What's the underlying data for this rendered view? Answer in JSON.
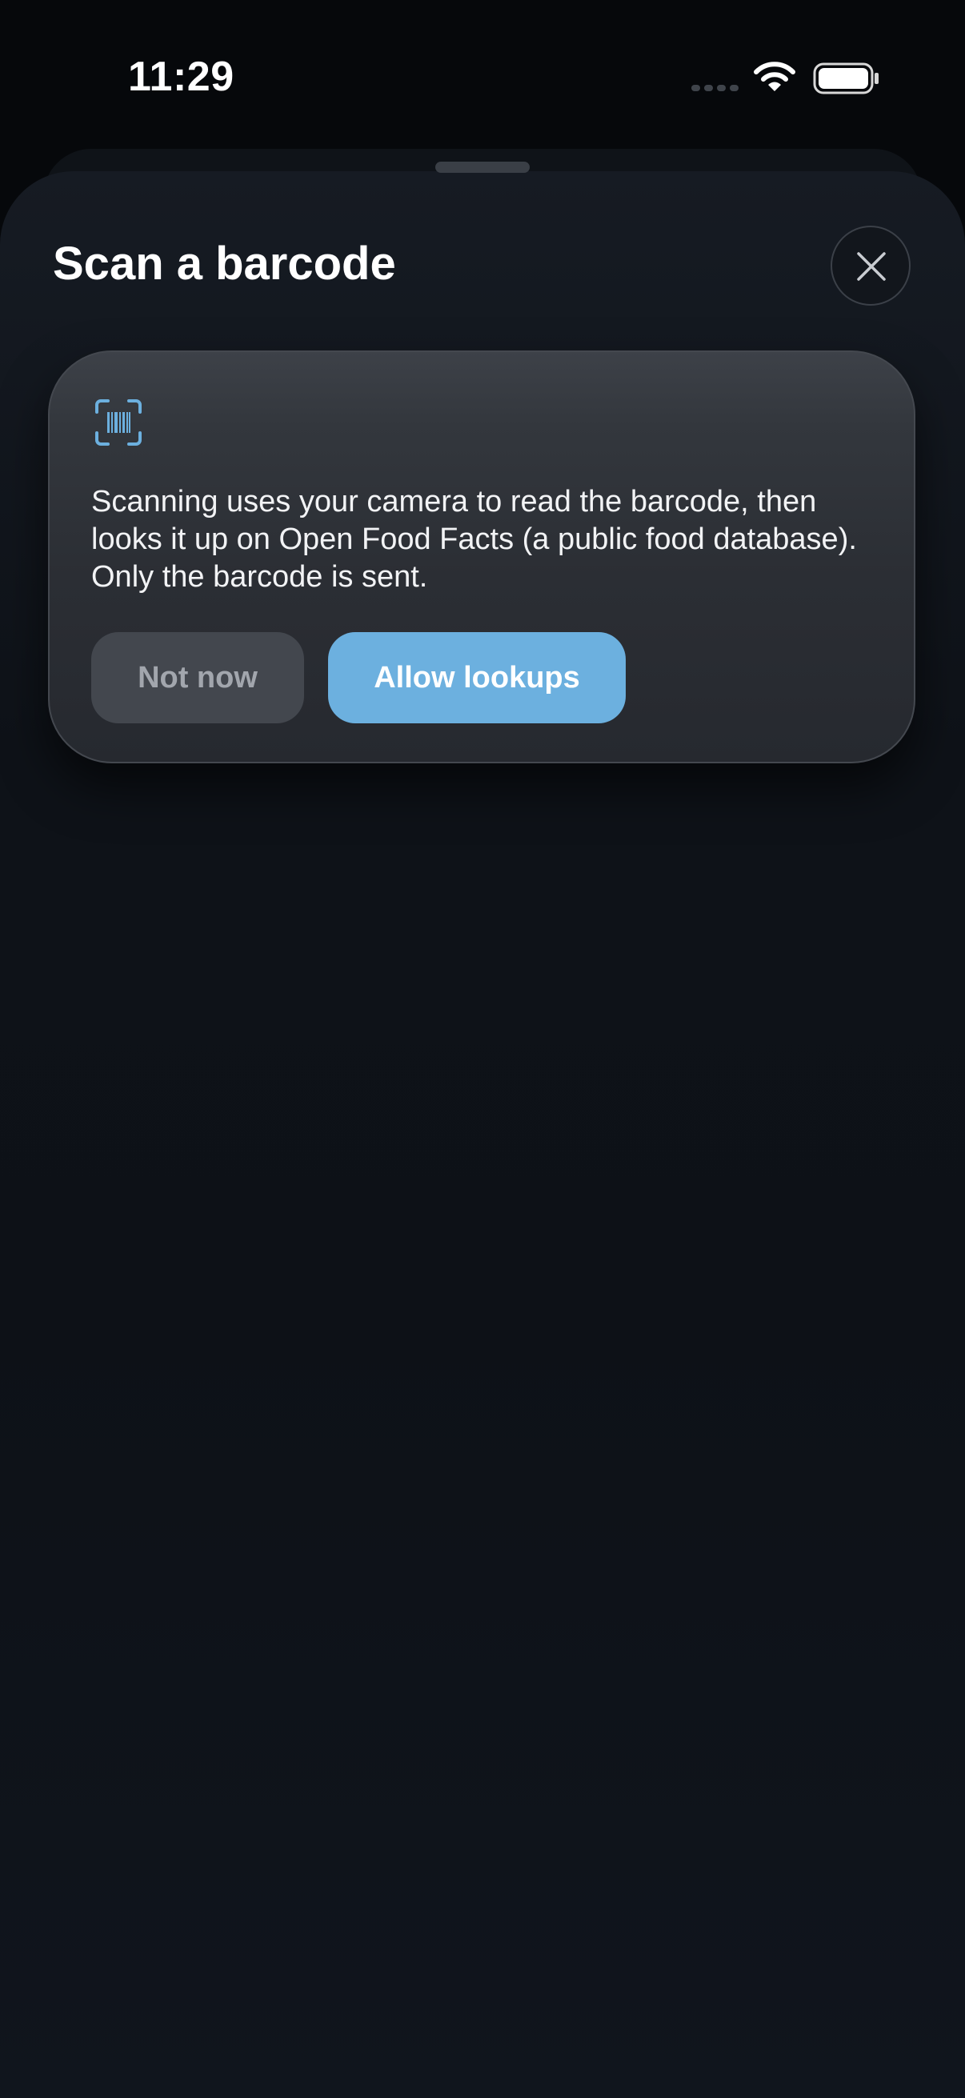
{
  "status_bar": {
    "time": "11:29",
    "icons": [
      "signal-icon",
      "wifi-icon",
      "battery-icon"
    ]
  },
  "sheet": {
    "title": "Scan a barcode",
    "close_icon": "close-icon"
  },
  "consent_card": {
    "icon": "barcode-scan-icon",
    "message": "Scanning uses your camera to read the barcode, then looks it up on Open Food Facts (a public food database). Only the barcode is sent.",
    "secondary_button": "Not now",
    "primary_button": "Allow lookups"
  },
  "colors": {
    "accent": "#6cb0df",
    "background": "#0d1117",
    "card": "#2b2e34"
  }
}
